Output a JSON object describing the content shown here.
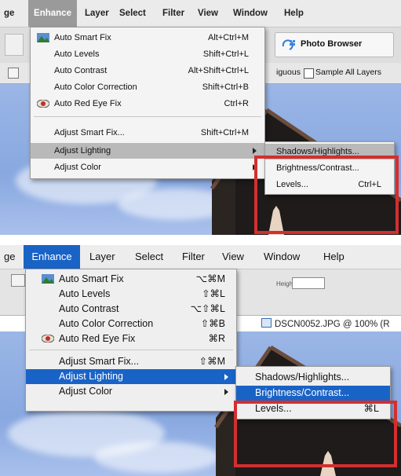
{
  "panel1": {
    "menubar": [
      "ge",
      "Enhance",
      "Layer",
      "Select",
      "Filter",
      "View",
      "Window",
      "Help"
    ],
    "toolbar": {
      "photo_browser": "Photo Browser"
    },
    "options": {
      "partial": "iguous",
      "sample_all_layers": "Sample All Layers"
    },
    "enhance_menu": [
      {
        "label": "Auto Smart Fix",
        "shortcut": "Alt+Ctrl+M"
      },
      {
        "label": "Auto Levels",
        "shortcut": "Shift+Ctrl+L"
      },
      {
        "label": "Auto Contrast",
        "shortcut": "Alt+Shift+Ctrl+L"
      },
      {
        "label": "Auto Color Correction",
        "shortcut": "Shift+Ctrl+B"
      },
      {
        "label": "Auto Red Eye Fix",
        "shortcut": "Ctrl+R"
      },
      {
        "label": "Adjust Smart Fix...",
        "shortcut": "Shift+Ctrl+M"
      },
      {
        "label": "Adjust Lighting",
        "shortcut": ""
      },
      {
        "label": "Adjust Color",
        "shortcut": ""
      }
    ],
    "submenu": [
      {
        "label": "Shadows/Highlights...",
        "shortcut": ""
      },
      {
        "label": "Brightness/Contrast...",
        "shortcut": ""
      },
      {
        "label": "Levels...",
        "shortcut": "Ctrl+L"
      }
    ]
  },
  "panel2": {
    "menubar": [
      "ge",
      "Enhance",
      "Layer",
      "Select",
      "Filter",
      "View",
      "Window",
      "Help"
    ],
    "height_label": "Height:",
    "doc_tab": "DSCN0052.JPG @ 100% (R",
    "enhance_menu": [
      {
        "label": "Auto Smart Fix",
        "shortcut": "⌥⌘M"
      },
      {
        "label": "Auto Levels",
        "shortcut": "⇧⌘L"
      },
      {
        "label": "Auto Contrast",
        "shortcut": "⌥⇧⌘L"
      },
      {
        "label": "Auto Color Correction",
        "shortcut": "⇧⌘B"
      },
      {
        "label": "Auto Red Eye Fix",
        "shortcut": "⌘R"
      },
      {
        "label": "Adjust Smart Fix...",
        "shortcut": "⇧⌘M"
      },
      {
        "label": "Adjust Lighting",
        "shortcut": ""
      },
      {
        "label": "Adjust Color",
        "shortcut": ""
      }
    ],
    "submenu": [
      {
        "label": "Shadows/Highlights...",
        "shortcut": ""
      },
      {
        "label": "Brightness/Contrast...",
        "shortcut": ""
      },
      {
        "label": "Levels...",
        "shortcut": "⌘L"
      }
    ]
  },
  "colors": {
    "highlight_mac": "#1a63c6",
    "callout_red": "#d32f2f"
  }
}
